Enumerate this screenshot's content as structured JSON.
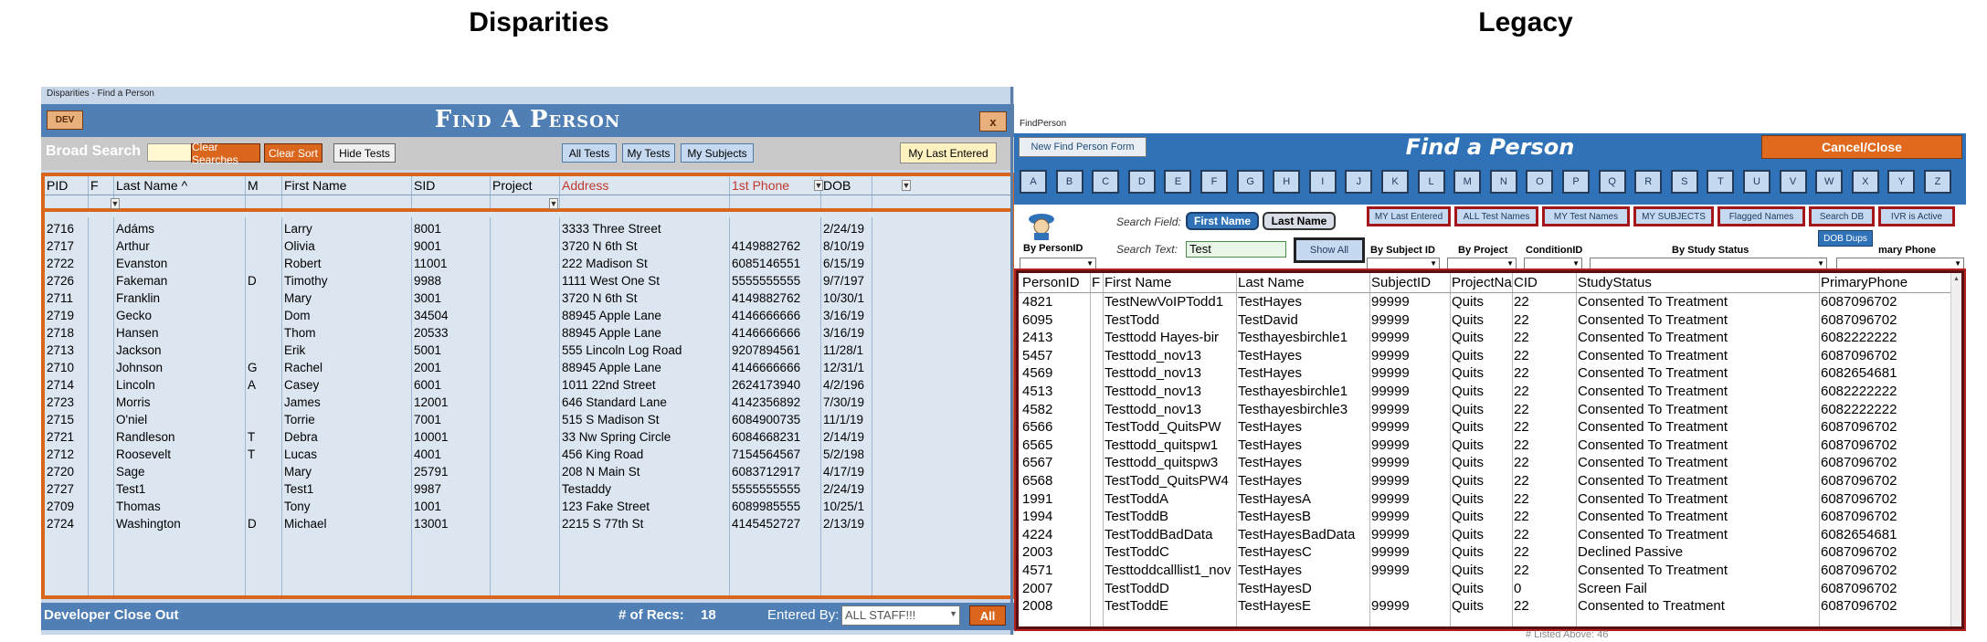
{
  "captions": {
    "left": "Disparities",
    "right": "Legacy"
  },
  "left": {
    "window_title": "Disparities - Find a Person",
    "dev_label": "DEV",
    "title": "Find A Person",
    "close_label": "x",
    "broad_search_label": "Broad Search",
    "broad_search_value": "",
    "buttons": {
      "clear_searches": "Clear Searches",
      "clear_sort": "Clear Sort",
      "hide_tests": "Hide Tests",
      "all_tests": "All Tests",
      "my_tests": "My Tests",
      "my_subjects": "My Subjects",
      "my_last_entered": "My Last Entered"
    },
    "columns": [
      "PID",
      "F",
      "Last Name ^",
      "M",
      "First Name",
      "SID",
      "Project",
      "Address",
      "1st Phone",
      "DOB"
    ],
    "rows": [
      [
        "2716",
        "",
        "Adáms",
        "",
        "Larry",
        "8001",
        "",
        "3333 Three Street",
        "",
        "2/24/19"
      ],
      [
        "2717",
        "",
        "Arthur",
        "",
        "Olivia",
        "9001",
        "",
        "3720 N 6th St",
        "4149882762",
        "8/10/19"
      ],
      [
        "2722",
        "",
        "Evanston",
        "",
        "Robert",
        "11001",
        "",
        "222 Madison St",
        "6085146551",
        "6/15/19"
      ],
      [
        "2726",
        "",
        "Fakeman",
        "D",
        "Timothy",
        "9988",
        "",
        "1111 West One St",
        "5555555555",
        "9/7/197"
      ],
      [
        "2711",
        "",
        "Franklin",
        "",
        "Mary",
        "3001",
        "",
        "3720 N 6th St",
        "4149882762",
        "10/30/1"
      ],
      [
        "2719",
        "",
        "Gecko",
        "",
        "Dom",
        "34504",
        "",
        "88945 Apple Lane",
        "4146666666",
        "3/16/19"
      ],
      [
        "2718",
        "",
        "Hansen",
        "",
        "Thom",
        "20533",
        "",
        "88945 Apple Lane",
        "4146666666",
        "3/16/19"
      ],
      [
        "2713",
        "",
        "Jackson",
        "",
        "Erik",
        "5001",
        "",
        "555 Lincoln Log Road",
        "9207894561",
        "11/28/1"
      ],
      [
        "2710",
        "",
        "Johnson",
        "G",
        "Rachel",
        "2001",
        "",
        "88945 Apple Lane",
        "4146666666",
        "12/31/1"
      ],
      [
        "2714",
        "",
        "Lincoln",
        "A",
        "Casey",
        "6001",
        "",
        "1011 22nd Street",
        "2624173940",
        "4/2/196"
      ],
      [
        "2723",
        "",
        "Morris",
        "",
        "James",
        "12001",
        "",
        "646 Standard Lane",
        "4142356892",
        "7/30/19"
      ],
      [
        "2715",
        "",
        "O'niel",
        "",
        "Torrie",
        "7001",
        "",
        "515 S Madison St",
        "6084900735",
        "11/1/19"
      ],
      [
        "2721",
        "",
        "Randleson",
        "T",
        "Debra",
        "10001",
        "",
        "33 Nw Spring Circle",
        "6084668231",
        "2/14/19"
      ],
      [
        "2712",
        "",
        "Roosevelt",
        "T",
        "Lucas",
        "4001",
        "",
        "456 King Road",
        "7154564567",
        "5/2/198"
      ],
      [
        "2720",
        "",
        "Sage",
        "",
        "Mary",
        "25791",
        "",
        "208 N Main St",
        "6083712917",
        "4/17/19"
      ],
      [
        "2727",
        "",
        "Test1",
        "",
        "Test1",
        "9987",
        "",
        "Testaddy",
        "5555555555",
        "2/24/19"
      ],
      [
        "2709",
        "",
        "Thomas",
        "",
        "Tony",
        "1001",
        "",
        "123 Fake Street",
        "6089985555",
        "10/25/1"
      ],
      [
        "2724",
        "",
        "Washington",
        "D",
        "Michael",
        "13001",
        "",
        "2215 S 77th St",
        "4145452727",
        "2/13/19"
      ]
    ],
    "footer": {
      "developer_close_out": "Developer Close Out",
      "recs_label": "# of Recs:",
      "recs_value": "18",
      "entered_by_label": "Entered By:",
      "entered_by_value": "ALL STAFF!!!",
      "all_button": "All"
    }
  },
  "right": {
    "window_title": "FindPerson",
    "new_form_button": "New Find Person Form",
    "title": "Find a Person",
    "cancel_button": "Cancel/Close",
    "letters": [
      "A",
      "B",
      "C",
      "D",
      "E",
      "F",
      "G",
      "H",
      "I",
      "J",
      "K",
      "L",
      "M",
      "N",
      "O",
      "P",
      "Q",
      "R",
      "S",
      "T",
      "U",
      "V",
      "W",
      "X",
      "Y",
      "Z"
    ],
    "by_personid_label": "By PersonID",
    "search_field_label": "Search Field:",
    "first_name_toggle": "First Name",
    "last_name_toggle": "Last Name",
    "search_text_label": "Search Text:",
    "search_text_value": "Test",
    "show_all": "Show All",
    "filter_buttons": [
      "MY Last Entered",
      "ALL Test Names",
      "MY Test Names",
      "MY SUBJECTS",
      "Flagged Names",
      "Search DB",
      "IVR is Active"
    ],
    "dob_dups": "DOB Dups",
    "by_subject_id": "By Subject ID",
    "by_project": "By Project",
    "condition_id": "ConditionID",
    "by_study_status": "By Study Status",
    "primary_phone_label": "mary Phone",
    "columns": [
      "PersonID",
      "F",
      "First Name",
      "Last Name",
      "SubjectID",
      "ProjectNa",
      "CID",
      "StudyStatus",
      "PrimaryPhone"
    ],
    "rows": [
      [
        "4821",
        "",
        "TestNewVoIPTodd1",
        "TestHayes",
        "99999",
        "Quits",
        "22",
        "Consented To Treatment",
        "6087096702"
      ],
      [
        "6095",
        "",
        "TestTodd",
        "TestDavid",
        "99999",
        "Quits",
        "22",
        "Consented To Treatment",
        "6087096702"
      ],
      [
        "2413",
        "",
        "Testtodd Hayes-bir",
        "Testhayesbirchle1",
        "99999",
        "Quits",
        "22",
        "Consented To Treatment",
        "6082222222"
      ],
      [
        "5457",
        "",
        "Testtodd_nov13",
        "TestHayes",
        "99999",
        "Quits",
        "22",
        "Consented To Treatment",
        "6087096702"
      ],
      [
        "4569",
        "",
        "Testtodd_nov13",
        "TestHayes",
        "99999",
        "Quits",
        "22",
        "Consented To Treatment",
        "6082654681"
      ],
      [
        "4513",
        "",
        "Testtodd_nov13",
        "Testhayesbirchle1",
        "99999",
        "Quits",
        "22",
        "Consented To Treatment",
        "6082222222"
      ],
      [
        "4582",
        "",
        "Testtodd_nov13",
        "Testhayesbirchle3",
        "99999",
        "Quits",
        "22",
        "Consented To Treatment",
        "6082222222"
      ],
      [
        "6566",
        "",
        "TestTodd_QuitsPW",
        "TestHayes",
        "99999",
        "Quits",
        "22",
        "Consented To Treatment",
        "6087096702"
      ],
      [
        "6565",
        "",
        "Testtodd_quitspw1",
        "TestHayes",
        "99999",
        "Quits",
        "22",
        "Consented To Treatment",
        "6087096702"
      ],
      [
        "6567",
        "",
        "Testtodd_quitspw3",
        "TestHayes",
        "99999",
        "Quits",
        "22",
        "Consented To Treatment",
        "6087096702"
      ],
      [
        "6568",
        "",
        "TestTodd_QuitsPW4",
        "TestHayes",
        "99999",
        "Quits",
        "22",
        "Consented To Treatment",
        "6087096702"
      ],
      [
        "1991",
        "",
        "TestToddA",
        "TestHayesA",
        "99999",
        "Quits",
        "22",
        "Consented To Treatment",
        "6087096702"
      ],
      [
        "1994",
        "",
        "TestToddB",
        "TestHayesB",
        "99999",
        "Quits",
        "22",
        "Consented To Treatment",
        "6087096702"
      ],
      [
        "4224",
        "",
        "TestToddBadData",
        "TestHayesBadData",
        "99999",
        "Quits",
        "22",
        "Consented To Treatment",
        "6082654681"
      ],
      [
        "2003",
        "",
        "TestToddC",
        "TestHayesC",
        "99999",
        "Quits",
        "22",
        "Declined Passive",
        "6087096702"
      ],
      [
        "4571",
        "",
        "Testtoddcalllist1_nov",
        "TestHayes",
        "99999",
        "Quits",
        "22",
        "Consented To Treatment",
        "6087096702"
      ],
      [
        "2007",
        "",
        "TestToddD",
        "TestHayesD",
        "",
        "Quits",
        "0",
        "Screen Fail",
        "6087096702"
      ],
      [
        "2008",
        "",
        "TestToddE",
        "TestHayesE",
        "99999",
        "Quits",
        "22",
        "Consented to Treatment",
        "6087096702"
      ]
    ],
    "footer_text": "# Listed Above: 46"
  },
  "colors": {
    "left_header_blue": "#4f7fb4",
    "left_accent_orange": "#d9661c",
    "left_grid_bg": "#dce6f1",
    "right_header_blue": "#2f72b7",
    "right_grid_border_red": "#b21f1f"
  }
}
